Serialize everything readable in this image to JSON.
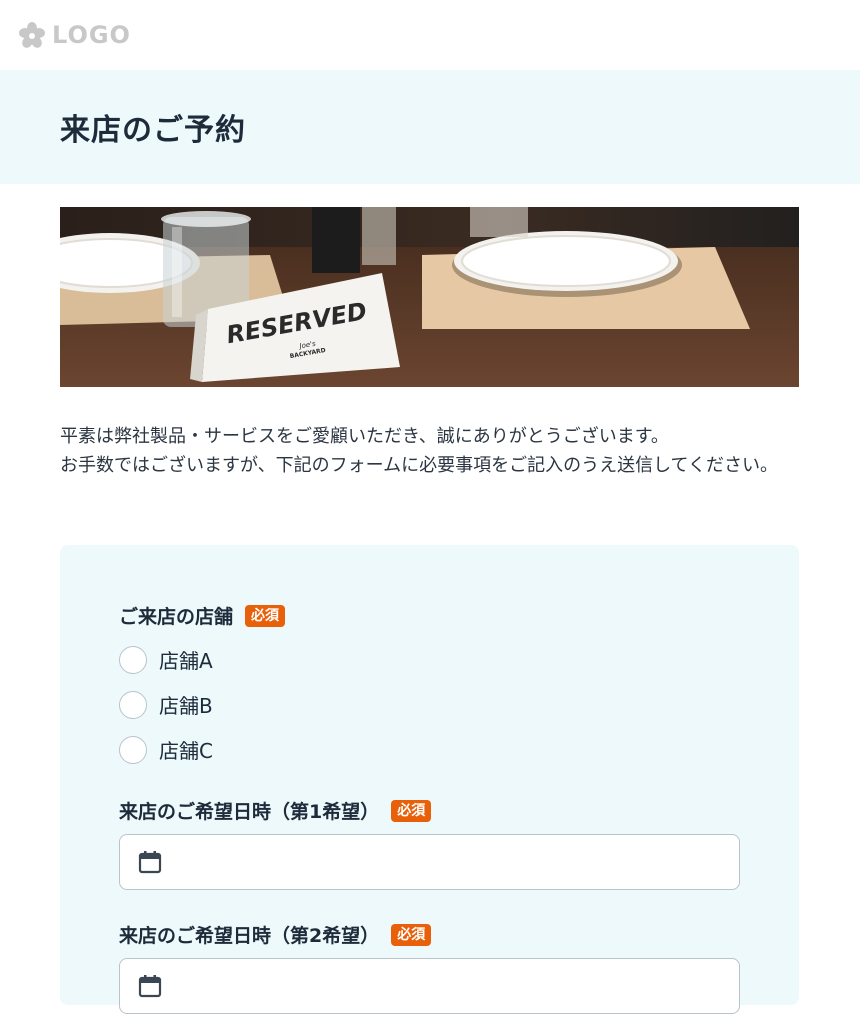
{
  "header": {
    "logo_text": "LOGO",
    "logo_icon": "flower-icon"
  },
  "page": {
    "title": "来店のご予約"
  },
  "hero": {
    "sign_text": "RESERVED",
    "sign_subtext_1": "Joe's",
    "sign_subtext_2": "BACKYARD"
  },
  "intro": {
    "line1": "平素は弊社製品・サービスをご愛顧いただき、誠にありがとうございます。",
    "line2": "お手数ではございますが、下記のフォームに必要事項をご記入のうえ送信してください。"
  },
  "form": {
    "store": {
      "label": "ご来店の店舗",
      "required": "必須",
      "options": [
        "店舗A",
        "店舗B",
        "店舗C"
      ]
    },
    "date1": {
      "label": "来店のご希望日時（第1希望）",
      "required": "必須",
      "value": ""
    },
    "date2": {
      "label": "来店のご希望日時（第2希望）",
      "required": "必須",
      "value": ""
    }
  },
  "colors": {
    "accent_band": "#eef9fc",
    "required_badge": "#e8600a",
    "text_dark": "#1d2b3a"
  }
}
